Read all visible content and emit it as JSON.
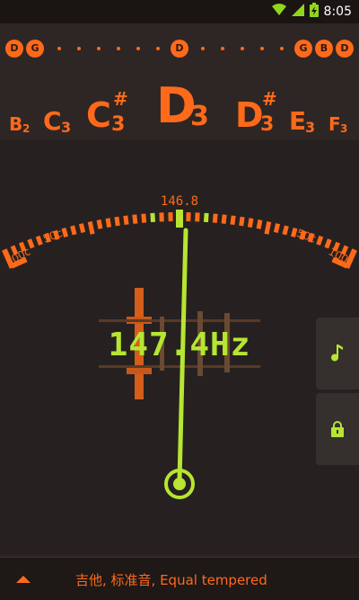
{
  "status": {
    "time": "8:05"
  },
  "strings": [
    "D",
    "G",
    "D",
    "G",
    "B",
    "D"
  ],
  "notes": {
    "b2": {
      "letter": "B",
      "octave": "2",
      "sharp": ""
    },
    "c3": {
      "letter": "C",
      "octave": "3",
      "sharp": ""
    },
    "csharp3": {
      "letter": "C",
      "octave": "3",
      "sharp": "#"
    },
    "d3": {
      "letter": "D",
      "octave": "3",
      "sharp": ""
    },
    "dsharp3": {
      "letter": "D",
      "octave": "3",
      "sharp": "#"
    },
    "e3": {
      "letter": "E",
      "octave": "3",
      "sharp": ""
    },
    "f3": {
      "letter": "F",
      "octave": "3",
      "sharp": ""
    }
  },
  "gauge": {
    "target_freq": "146.8",
    "left_100": "100c",
    "left_50": "50c",
    "right_50": "50c",
    "right_100": "100c"
  },
  "readout": {
    "frequency": "147.4Hz"
  },
  "bottom": {
    "tuning": "吉他, 标准音, Equal tempered"
  },
  "colors": {
    "accent": "#ff6a1a",
    "needle": "#b6e532",
    "background": "#262120"
  },
  "icons": {
    "note_button": "music-note-icon",
    "lock_button": "lock-icon",
    "expand": "triangle-up-icon"
  }
}
